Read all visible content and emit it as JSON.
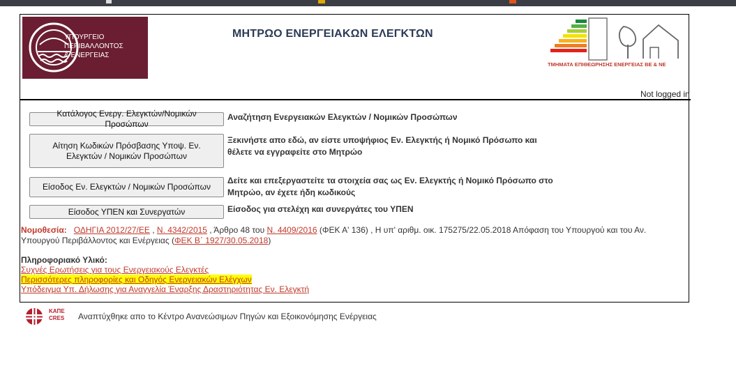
{
  "colors": {
    "brand": "#6b1e31",
    "link": "#c0392b",
    "highlight": "#ffff00"
  },
  "ministry_logo": {
    "lines": [
      "ΥΠΟΥΡΓΕΙΟ",
      "ΠΕΡΙΒΑΛΛΟΝΤΟΣ",
      "& ΕΝΕΡΓΕΙΑΣ"
    ]
  },
  "page_title": "ΜΗΤΡΩΟ ΕΝΕΡΓΕΙΑΚΩΝ ΕΛΕΓΚΤΩΝ",
  "energy_logo": {
    "caption": "ΤΜΗΜΑΤΑ ΕΠΙΘΕΩΡΗΣΗΣ ΕΝΕΡΓΕΙΑΣ ΒΕ & ΝΕ"
  },
  "login_status": "Not logged in",
  "actions": [
    {
      "button": "Κατάλογος Ενεργ. Ελεγκτών/Νομικών Προσώπων",
      "description": "Αναζήτηση Ενεργειακών Ελεγκτών / Νομικών Προσώπων"
    },
    {
      "button": "Αίτηση Κωδικών Πρόσβασης Υποψ. Εν. Ελεγκτών / Νομικών Προσώπων",
      "description": "Ξεκινήστε απο εδώ, αν είστε υποψήφιος Εν. Ελεγκτής ή Νομικό Πρόσωπο και θέλετε να εγγραφείτε στο Μητρώο"
    },
    {
      "button": "Είσοδος Εν. Ελεγκτών / Νομικών Προσώπων",
      "description": "Δείτε και επεξεργαστείτε τα στοιχεία σας ως Εν. Ελεγκτής ή Νομικό Πρόσωπο στο Μητρώο, αν έχετε ήδη κωδικούς"
    },
    {
      "button": "Είσοδος ΥΠΕΝ και Συνεργατών",
      "description": "Είσοδος για στελέχη και συνεργάτες του ΥΠΕΝ"
    }
  ],
  "legislation": {
    "label": "Νομοθεσία:",
    "link1": "ΟΔΗΓΙΑ 2012/27/ΕΕ",
    "sep1": " , ",
    "link2": "Ν. 4342/2015",
    "text1": " , Άρθρο 48 του ",
    "link3": "Ν. 4409/2016",
    "text2": " (ΦΕΚ Α' 136) , Η υπ' αριθμ. οικ. 175275/22.05.2018 Απόφαση του Υπουργού και του Αν. Υπουργού Περιβάλλοντος και Ενέργειας (",
    "link4": "ΦΕΚ Β΄ 1927/30.05.2018",
    "text3": ")"
  },
  "info": {
    "title": "Πληροφοριακό Υλικό:",
    "links": [
      "Συχνές Ερωτήσεις για τους Ενεργειακούς Ελεγκτές",
      "Περισσότερες πληροφορίες και Οδηγός Ενεργειακών Ελέγχων",
      "Υπόδειγμα Υπ. Δήλωσης για Αναγγελία Έναρξης Δραστηριότητας Εν. Ελεγκτή"
    ]
  },
  "footer": {
    "logo_text": [
      "ΚΑΠΕ",
      "CRES"
    ],
    "text": "Αναπτύχθηκε απο το Κέντρο Ανανεώσιμων Πηγών και Εξοικονόμησης Ενέργειας"
  }
}
